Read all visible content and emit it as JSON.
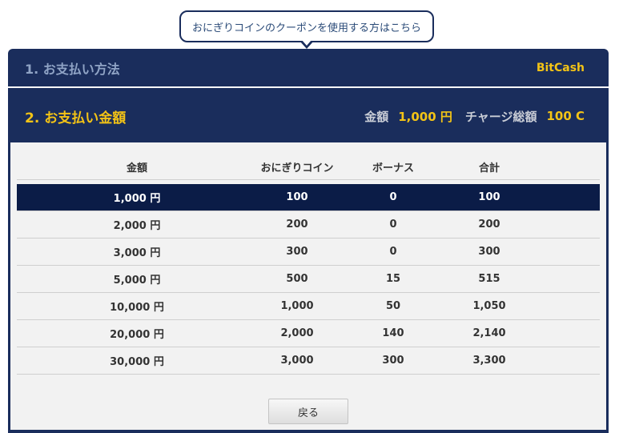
{
  "coupon_link": "おにぎりコインのクーポンを使用する方はこちら",
  "step1": {
    "title": "1. お支払い方法",
    "method": "BitCash"
  },
  "step2": {
    "title": "2. お支払い金額",
    "amount_label": "金額",
    "amount_value": "1,000 円",
    "charge_label": "チャージ総額",
    "charge_value": "100 C"
  },
  "table": {
    "headers": [
      "金額",
      "おにぎりコイン",
      "ボーナス",
      "合計"
    ],
    "selected_row": 0,
    "rows": [
      [
        "1,000 円",
        "100",
        "0",
        "100"
      ],
      [
        "2,000 円",
        "200",
        "0",
        "200"
      ],
      [
        "3,000 円",
        "300",
        "0",
        "300"
      ],
      [
        "5,000 円",
        "500",
        "15",
        "515"
      ],
      [
        "10,000 円",
        "1,000",
        "50",
        "1,050"
      ],
      [
        "20,000 円",
        "2,000",
        "140",
        "2,140"
      ],
      [
        "30,000 円",
        "3,000",
        "300",
        "3,300"
      ]
    ]
  },
  "back_button": "戻る",
  "colors": {
    "navy": "#1a2d5c",
    "selected_row": "#0b1c47",
    "accent_yellow": "#f3c316",
    "content_bg": "#f2f2f2"
  }
}
